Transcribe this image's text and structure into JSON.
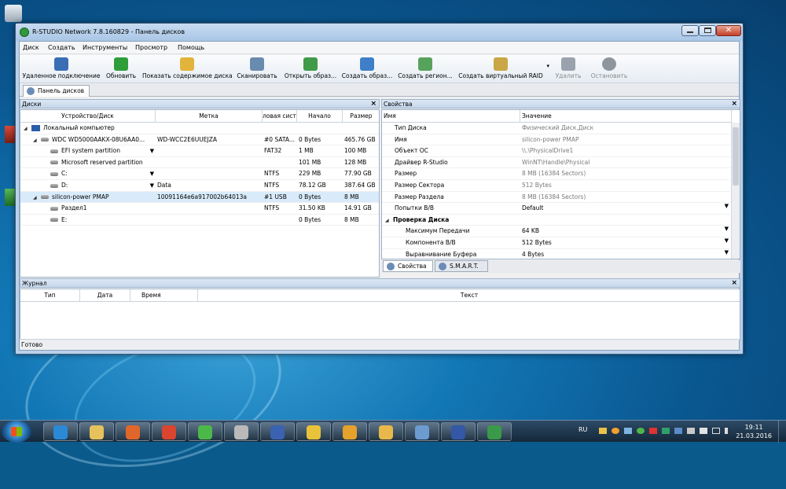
{
  "window": {
    "title": "R-STUDIO Network 7.8.160829 - Панель дисков"
  },
  "menu": [
    "Диск",
    "Создать",
    "Инструменты",
    "Просмотр",
    "Помощь"
  ],
  "toolbar": [
    {
      "label": "Удаленное подключение",
      "icon": "remote-connect-icon",
      "color": "#3a6fb5",
      "disabled": false
    },
    {
      "label": "Обновить",
      "icon": "refresh-icon",
      "color": "#2e9e3a",
      "disabled": false
    },
    {
      "label": "Показать содержимое диска",
      "icon": "folder-icon",
      "color": "#e2b43c",
      "disabled": false
    },
    {
      "label": "Сканировать",
      "icon": "scan-icon",
      "color": "#6a8bb0",
      "disabled": false
    },
    {
      "label": "Открыть образ...",
      "icon": "open-image-icon",
      "color": "#3f9b48",
      "disabled": false
    },
    {
      "label": "Создать образ...",
      "icon": "create-image-icon",
      "color": "#3f7fc9",
      "disabled": false
    },
    {
      "label": "Создать регион...",
      "icon": "create-region-icon",
      "color": "#58a35c",
      "disabled": false
    },
    {
      "label": "Создать виртуальный RAID",
      "icon": "raid-icon",
      "color": "#c9a646",
      "disabled": false
    },
    {
      "label": "Удалить",
      "icon": "delete-icon",
      "color": "#9aa3ad",
      "disabled": true
    },
    {
      "label": "Остановить",
      "icon": "stop-icon",
      "color": "#8e959c",
      "disabled": true
    }
  ],
  "tab": {
    "label": "Панель дисков"
  },
  "disks_pane": {
    "title": "Диски",
    "columns": [
      "Устройство/Диск",
      "Метка",
      "ловая сист",
      "Начало",
      "Размер"
    ],
    "rows": [
      {
        "name": "Локальный компьютер",
        "label": "",
        "fs": "",
        "start": "",
        "size": ""
      },
      {
        "name": "WDC WD5000AAKX-08U6AA0...",
        "label": "WD-WCC2E6UUEJZA",
        "fs": "#0 SATA...",
        "start": "0 Bytes",
        "size": "465.76 GB"
      },
      {
        "name": "EFI system partition",
        "label": "",
        "fs": "FAT32",
        "start": "1 MB",
        "size": "100 MB"
      },
      {
        "name": "Microsoft reserved partition",
        "label": "",
        "fs": "",
        "start": "101 MB",
        "size": "128 MB"
      },
      {
        "name": "C:",
        "label": "",
        "fs": "NTFS",
        "start": "229 MB",
        "size": "77.90 GB"
      },
      {
        "name": "D:",
        "label": "Data",
        "fs": "NTFS",
        "start": "78.12 GB",
        "size": "387.64 GB"
      },
      {
        "name": "silicon-power PMAP",
        "label": "10091164e6a917002b64013a",
        "fs": "#1 USB",
        "start": "0 Bytes",
        "size": "8 MB"
      },
      {
        "name": "Раздел1",
        "label": "",
        "fs": "NTFS",
        "start": "31.50 KB",
        "size": "14.91 GB"
      },
      {
        "name": "E:",
        "label": "",
        "fs": "",
        "start": "0 Bytes",
        "size": "8 MB"
      }
    ]
  },
  "props_pane": {
    "title": "Свойства",
    "columns": [
      "Имя",
      "Значение"
    ],
    "rows": [
      {
        "name": "Тип Диска",
        "value": "Физический Диск,Диск"
      },
      {
        "name": "Имя",
        "value": "silicon-power PMAP"
      },
      {
        "name": "Объект ОС",
        "value": "\\\\.\\PhysicalDrive1"
      },
      {
        "name": "Драйвер R-Studio",
        "value": "WinNT\\Handle\\Physical"
      },
      {
        "name": "Размер",
        "value": "8 MB (16384 Sectors)"
      },
      {
        "name": "Размер Сектора",
        "value": "512 Bytes"
      },
      {
        "name": "Размер Раздела",
        "value": "8 MB (16384 Sectors)"
      },
      {
        "name": "Попытки В/В",
        "value": "Default"
      },
      {
        "name": "Проверка Диска",
        "value": ""
      },
      {
        "name": "Максимум Передачи",
        "value": "64 KB"
      },
      {
        "name": "Компонента В/В",
        "value": "512 Bytes"
      },
      {
        "name": "Выравнивание Буфера",
        "value": "4 Bytes"
      }
    ],
    "tabs": [
      "Свойства",
      "S.M.A.R.T."
    ]
  },
  "log_pane": {
    "title": "Журнал",
    "columns": [
      "Тип",
      "Дата",
      "Время",
      "Текст"
    ]
  },
  "status": "Готово",
  "taskbar": {
    "apps": [
      {
        "icon": "internet-explorer-icon",
        "color": "#2a8ad6"
      },
      {
        "icon": "file-explorer-icon",
        "color": "#e5c25c"
      },
      {
        "icon": "media-player-icon",
        "color": "#e0672a"
      },
      {
        "icon": "chrome-icon",
        "color": "#d9452f"
      },
      {
        "icon": "icq-icon",
        "color": "#4cb84a"
      },
      {
        "icon": "network-icon",
        "color": "#b9b9b9"
      },
      {
        "icon": "app-icon",
        "color": "#3a62b0"
      },
      {
        "icon": "1c-icon",
        "color": "#e8c23a"
      },
      {
        "icon": "1c-enterprise-icon",
        "color": "#e4a22c"
      },
      {
        "icon": "mail-icon",
        "color": "#e8b84a"
      },
      {
        "icon": "notes-icon",
        "color": "#6c9bd0"
      },
      {
        "icon": "calculator-icon",
        "color": "#3457a6"
      },
      {
        "icon": "r-studio-icon",
        "color": "#3a9a4a"
      }
    ],
    "lang": "RU",
    "time": "19:11",
    "date": "21.03.2016"
  }
}
